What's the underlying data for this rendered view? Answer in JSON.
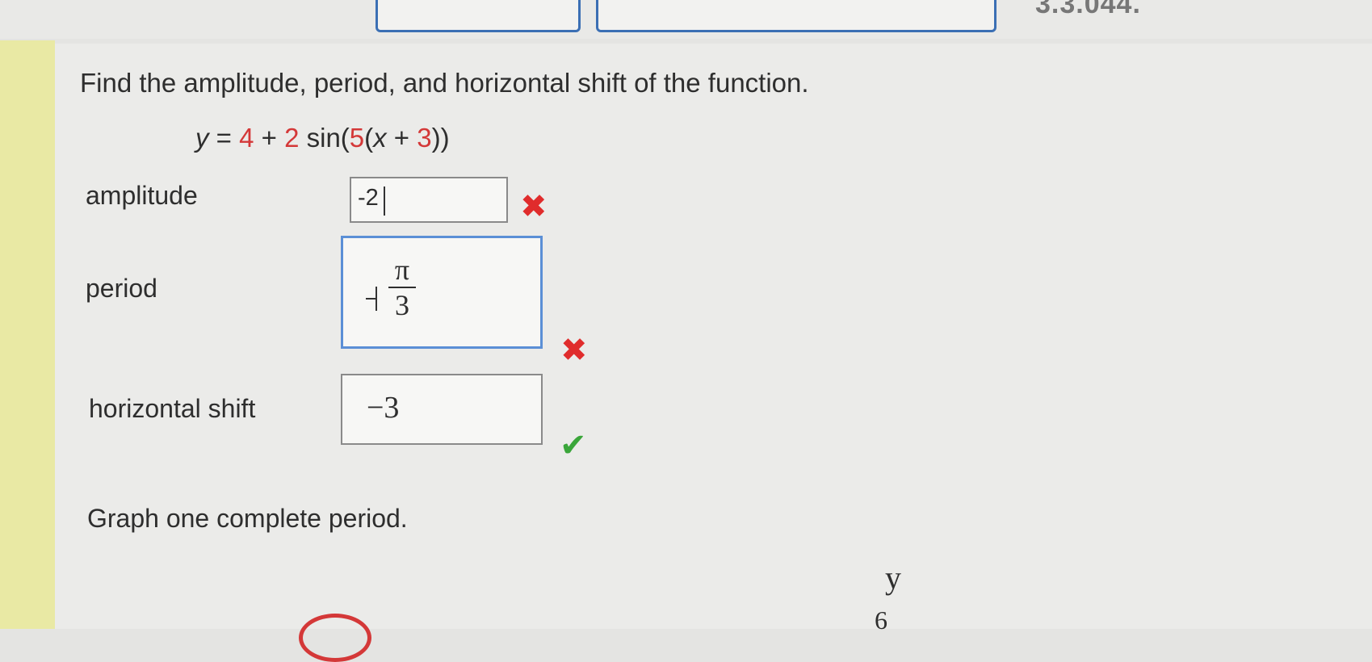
{
  "header": {
    "ref_text": "3.3.044."
  },
  "question": {
    "prompt": "Find the amplitude, period, and horizontal shift of the function.",
    "equation_lhs": "y",
    "equation_eq": " = ",
    "equation_c": "4",
    "equation_plus": " + ",
    "equation_a": "2",
    "equation_sin": " sin(",
    "equation_b": "5",
    "equation_open": "(",
    "equation_x": "x",
    "equation_plus2": " + ",
    "equation_shift": "3",
    "equation_close": "))"
  },
  "answers": {
    "amplitude": {
      "label": "amplitude",
      "value": "-2",
      "status": "incorrect"
    },
    "period": {
      "label": "period",
      "numerator": "π",
      "denominator": "3",
      "status": "incorrect"
    },
    "horizontal_shift": {
      "label": "horizontal shift",
      "value": "−3",
      "status": "correct"
    }
  },
  "graph": {
    "prompt": "Graph one complete period.",
    "y_axis_label": "y",
    "top_tick_label": "6"
  },
  "marks": {
    "incorrect_symbol": "✖",
    "correct_symbol": "✔",
    "incorrect_color": "#e02c2c",
    "correct_color": "#3aa63a"
  }
}
